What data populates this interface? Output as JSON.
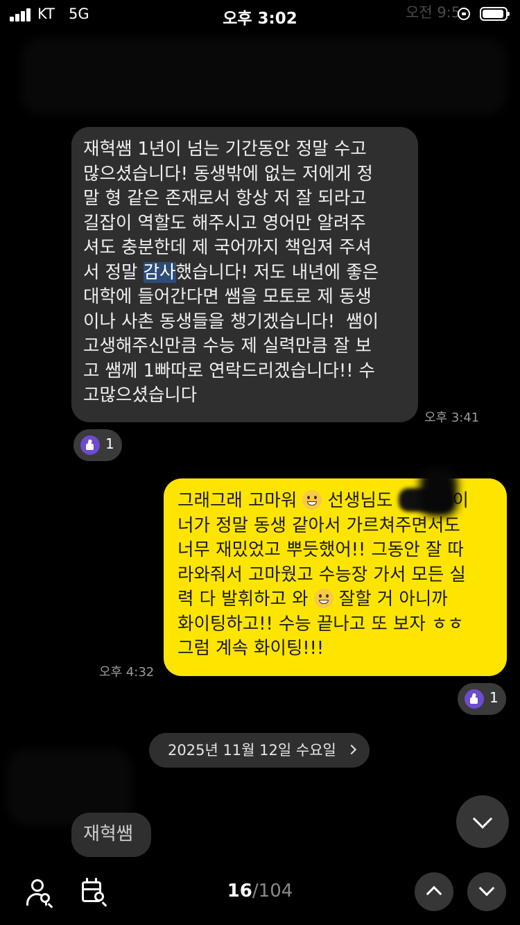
{
  "status_bar": {
    "carrier": "KT",
    "network": "5G",
    "time": "오후 3:02",
    "background_time": "오전 9:5"
  },
  "messages": [
    {
      "direction": "incoming",
      "lines_before_highlight": "재혁쌤 1년이 넘는 기간동안 정말 수고\n많으셨습니다! 동생밖에 없는 저에게 정\n말 형 같은 존재로서 항상 저 잘 되라고\n길잡이 역할도 해주시고 영어만 알려주\n셔도 충분한데 제 국어까지 책임져 주셔\n서 정말 ",
      "highlight": "감사",
      "lines_after_highlight": "했습니다! 저도 내년에 좋은\n대학에 들어간다면 쌤을 모토로 제 동생\n이나 사촌 동생들을 챙기겠습니다!  쌤이\n고생해주신만큼 수능 제 실력만큼 잘 보\n고 쌤께 1빠따로 연락드리겠습니다!! 수\n고많으셨습니다",
      "time": "오후 3:41",
      "reaction_count": "1"
    },
    {
      "direction": "outgoing",
      "part1": "그래그래 고마워 ",
      "part2": " 선생님도 ",
      "part3": "이\n너가 정말 동생 같아서 가르쳐주면서도\n너무 재밌었고 뿌듯했어!! 그동안 잘 따\n라와줘서 고마웠고 수능장 가서 모든 실\n력 다 발휘하고 와 ",
      "part4": " 잘할 거 아니까\n화이팅하고!! 수능 끝나고 또 보자 ㅎㅎ\n그럼 계속 화이팅!!!",
      "emoji_1": "grinning-face-emoji",
      "emoji_2": "smiling-face-emoji",
      "time": "오후 4:32",
      "reaction_count": "1"
    },
    {
      "direction": "incoming",
      "text": "재혁쌤"
    }
  ],
  "date_divider": "2025년 11월 12일 수요일",
  "search_nav": {
    "current": "16",
    "separator_total": "/104"
  },
  "colors": {
    "background": "#000000",
    "incoming_bubble": "#2f2f2f",
    "outgoing_bubble": "#fee500",
    "reaction_purple": "#6d4ccf",
    "highlight": "#2d4c77"
  },
  "icons": [
    "member-search-icon",
    "date-search-icon",
    "scroll-down-icon",
    "prev-result-icon",
    "next-result-icon"
  ]
}
